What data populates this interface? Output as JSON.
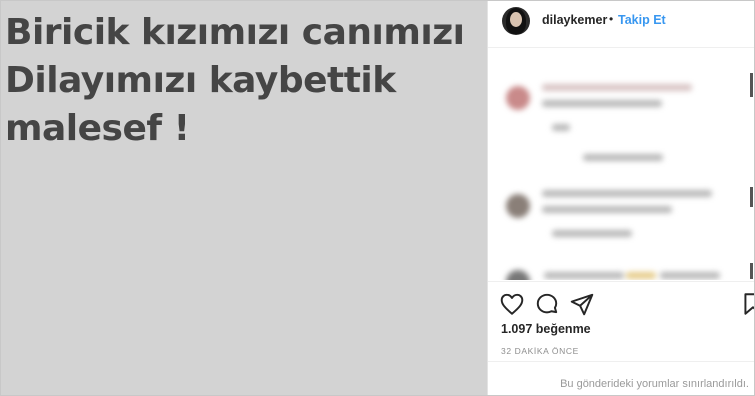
{
  "post": {
    "image_text": "Biricik kızımızı canımızı\nDilayımızı kaybettik\nmalesef !"
  },
  "header": {
    "username": "dilaykemer",
    "separator": "•",
    "follow_label": "Takip Et"
  },
  "actions": {
    "like_icon": "heart-icon",
    "comment_icon": "comment-icon",
    "share_icon": "send-icon",
    "save_icon": "bookmark-icon"
  },
  "likes_text": "1.097 beğenme",
  "time_text": "32 DAKİKA ÖNCE",
  "comments_restricted_text": "Bu gönderideki yorumlar sınırlandırıldı.",
  "colors": {
    "image_bg": "#d3d3d3",
    "image_text": "#454545",
    "link": "#3897f0",
    "muted": "#8e8e8e"
  }
}
